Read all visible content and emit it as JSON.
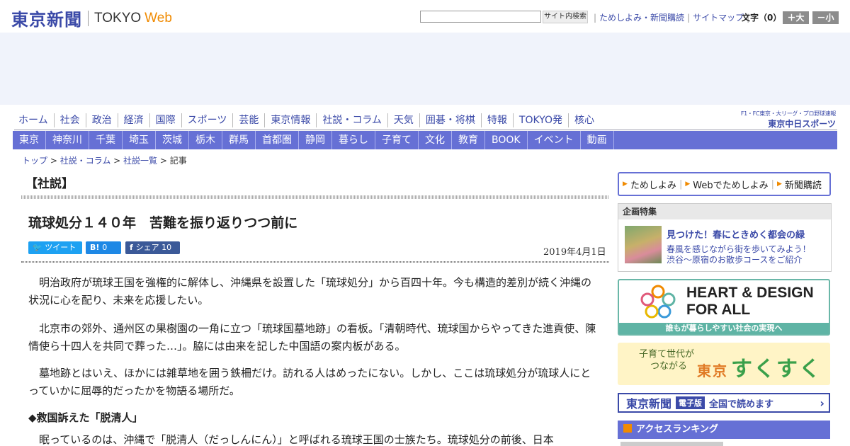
{
  "header": {
    "logo_jp": "東京新聞",
    "logo_tokyo": "TOKYO",
    "logo_web": "Web",
    "search_button": "サイト内検索",
    "links": [
      "ためしよみ・新聞購読",
      "サイトマップ"
    ],
    "font_size_label": "文字（0）",
    "font_larger": "＋大",
    "font_smaller": "－小"
  },
  "nav_main": [
    "ホーム",
    "社会",
    "政治",
    "経済",
    "国際",
    "スポーツ",
    "芸能",
    "東京情報",
    "社説・コラム",
    "天気",
    "囲碁・将棋",
    "特報",
    "TOKYO発",
    "核心"
  ],
  "chunichi": {
    "small": "F1・FC東京・大リーグ・プロ野球速報",
    "big": "東京中日スポーツ"
  },
  "nav_regional": [
    "東京",
    "神奈川",
    "千葉",
    "埼玉",
    "茨城",
    "栃木",
    "群馬",
    "首都圏",
    "静岡",
    "暮らし",
    "子育て",
    "文化",
    "教育",
    "BOOK",
    "イベント",
    "動画"
  ],
  "breadcrumb": {
    "items": [
      "トップ",
      "社説・コラム",
      "社説一覧"
    ],
    "current": "記事",
    "sep": " > "
  },
  "article": {
    "section": "【社説】",
    "headline": "琉球処分１４０年　苦難を振り返りつつ前に",
    "share": {
      "tweet": "ツイート",
      "hatena": "0",
      "fb_label": "シェア",
      "fb_count": "10"
    },
    "date": "2019年4月1日",
    "paragraphs": [
      "　明治政府が琉球王国を強権的に解体し、沖縄県を設置した「琉球処分」から百四十年。今も構造的差別が続く沖縄の状況に心を配り、未来を応援したい。",
      "　北京市の郊外、通州区の果樹園の一角に立つ「琉球国墓地跡」の看板。「清朝時代、琉球国からやってきた進貢使、陳情使ら十四人を共同で葬った…」。脇には由来を記した中国語の案内板がある。",
      "　墓地跡とはいえ、ほかには雑草地を囲う鉄柵だけ。訪れる人はめったにない。しかし、ここは琉球処分が琉球人にとっていかに屈辱的だったかを物語る場所だ。",
      "　眠っているのは、沖縄で「脱清人（だっしんにん）」と呼ばれる琉球王国の士族たち。琉球処分の前後、日本"
    ],
    "subhead": "◆救国訴えた「脱清人」"
  },
  "sidebar": {
    "promo": [
      "ためしよみ",
      "Webでためしよみ",
      "新聞購読"
    ],
    "feature": {
      "heading": "企画特集",
      "title": "見つけた！春にときめく都会の緑",
      "desc_line1": "春風を感じながら街を歩いてみよう！",
      "desc_line2": "渋谷～原宿のお散歩コースをご紹介"
    },
    "hd_banner": {
      "line1": "HEART & DESIGN",
      "line2": "FOR ALL",
      "foot": "誰もが暮らしやすい社会の実現へ"
    },
    "sukusuku": {
      "small1": "子育て世代が",
      "small2": "つながる",
      "tokyo": "東京",
      "big": "すくすく"
    },
    "digital": {
      "name": "東京新聞",
      "badge": "電子版",
      "text": "全国で読めます"
    },
    "ranking": "アクセスランキング"
  },
  "colors": {
    "brand": "#3b4aa8",
    "nav": "#6670d5",
    "accent": "#f08a00"
  }
}
